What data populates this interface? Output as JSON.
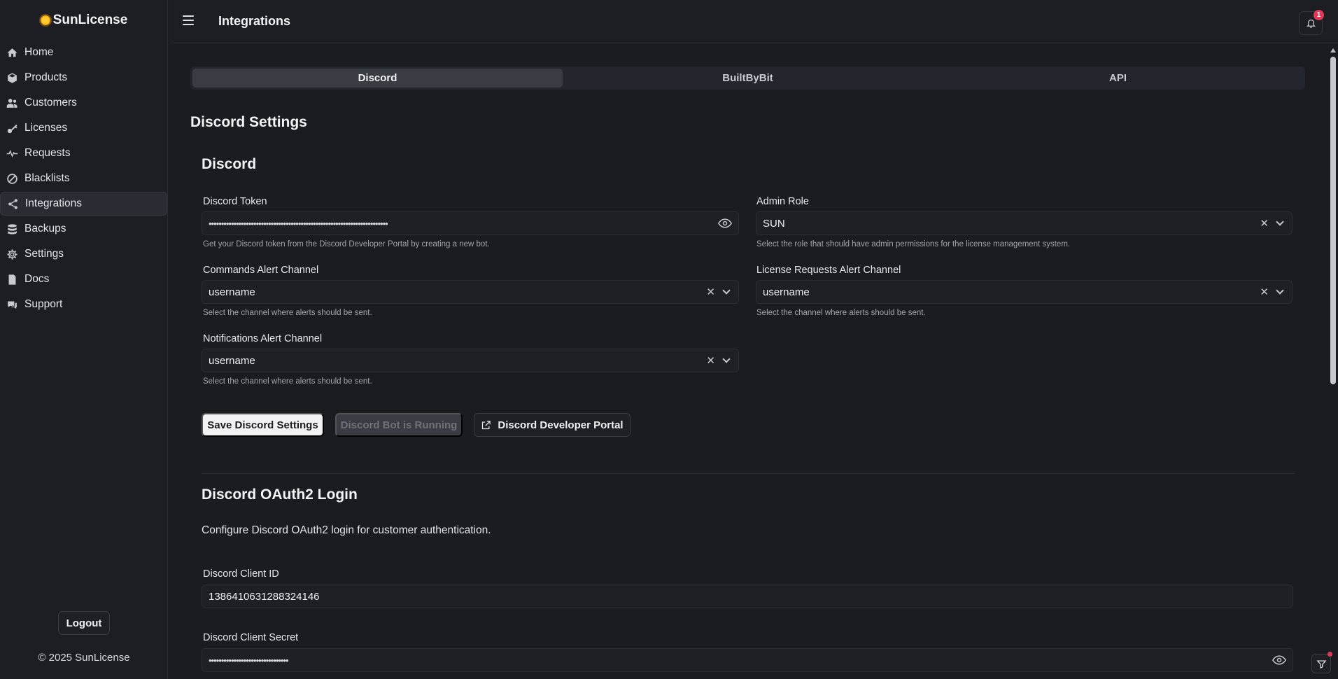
{
  "brand": {
    "name": "SunLicense"
  },
  "sidebar": {
    "items": [
      {
        "label": "Home",
        "icon": "home-icon"
      },
      {
        "label": "Products",
        "icon": "box-icon"
      },
      {
        "label": "Customers",
        "icon": "users-icon"
      },
      {
        "label": "Licenses",
        "icon": "key-icon"
      },
      {
        "label": "Requests",
        "icon": "pulse-icon"
      },
      {
        "label": "Blacklists",
        "icon": "ban-icon"
      },
      {
        "label": "Integrations",
        "icon": "share-icon",
        "active": true
      },
      {
        "label": "Backups",
        "icon": "database-icon"
      },
      {
        "label": "Settings",
        "icon": "gear-icon"
      },
      {
        "label": "Docs",
        "icon": "document-icon"
      },
      {
        "label": "Support",
        "icon": "chat-icon"
      }
    ],
    "logout_label": "Logout",
    "copyright": "© 2025 SunLicense"
  },
  "header": {
    "title": "Integrations",
    "notification_count": "1"
  },
  "tabs": [
    {
      "label": "Discord",
      "active": true
    },
    {
      "label": "BuiltByBit",
      "active": false
    },
    {
      "label": "API",
      "active": false
    }
  ],
  "main": {
    "section_title": "Discord Settings",
    "discord_heading": "Discord",
    "fields": {
      "discord_token": {
        "label": "Discord Token",
        "value": "••••••••••••••••••••••••••••••••••••••••••••••••••••••••••••••••••••••••",
        "hint": "Get your Discord token from the Discord Developer Portal by creating a new bot."
      },
      "admin_role": {
        "label": "Admin Role",
        "value": "SUN",
        "hint": "Select the role that should have admin permissions for the license management system."
      },
      "commands_alert_channel": {
        "label": "Commands Alert Channel",
        "value": "username",
        "hint": "Select the channel where alerts should be sent."
      },
      "license_requests_alert_channel": {
        "label": "License Requests Alert Channel",
        "value": "username",
        "hint": "Select the channel where alerts should be sent."
      },
      "notifications_alert_channel": {
        "label": "Notifications Alert Channel",
        "value": "username",
        "hint": "Select the channel where alerts should be sent."
      }
    },
    "buttons": {
      "save": "Save Discord Settings",
      "bot_status": "Discord Bot is Running",
      "developer_portal": "Discord Developer Portal"
    },
    "oauth": {
      "heading": "Discord OAuth2 Login",
      "description": "Configure Discord OAuth2 login for customer authentication.",
      "client_id_label": "Discord Client ID",
      "client_id_value": "1386410631288324146",
      "client_secret_label": "Discord Client Secret",
      "client_secret_value": "••••••••••••••••••••••••••••••••"
    }
  },
  "colors": {
    "background": "#1a1c22",
    "accent": "#f2f2f4",
    "badge": "#e0395a",
    "brand_sun": "#f5a623"
  }
}
